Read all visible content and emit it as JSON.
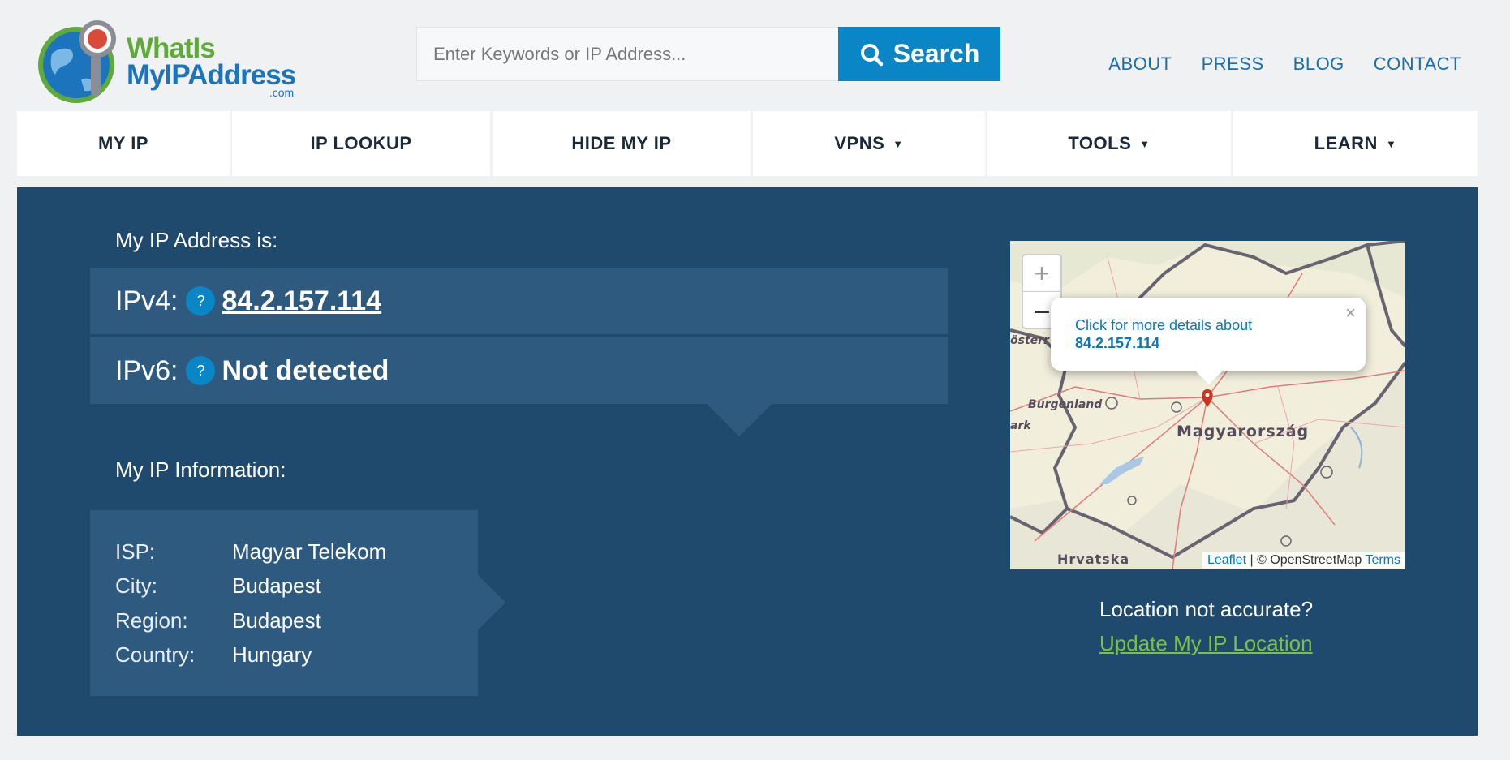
{
  "logo": {
    "line1": "WhatIs",
    "line2": "MyIPAddress",
    "line3": ".com"
  },
  "search": {
    "placeholder": "Enter Keywords or IP Address...",
    "button_label": "Search"
  },
  "top_links": [
    "ABOUT",
    "PRESS",
    "BLOG",
    "CONTACT"
  ],
  "nav": [
    {
      "label": "MY IP",
      "caret": ""
    },
    {
      "label": "IP LOOKUP",
      "caret": ""
    },
    {
      "label": "HIDE MY IP",
      "caret": ""
    },
    {
      "label": "VPNS",
      "caret": "▼"
    },
    {
      "label": "TOOLS",
      "caret": "▼"
    },
    {
      "label": "LEARN",
      "caret": "▼"
    }
  ],
  "ip": {
    "heading": "My IP Address is:",
    "ipv4_label": "IPv4:",
    "ipv4_value": "84.2.157.114",
    "ipv6_label": "IPv6:",
    "ipv6_value": "Not detected",
    "help": "?"
  },
  "info": {
    "heading": "My IP Information:",
    "rows": [
      {
        "key": "ISP:",
        "value": "Magyar Telekom"
      },
      {
        "key": "City:",
        "value": "Budapest"
      },
      {
        "key": "Region:",
        "value": "Budapest"
      },
      {
        "key": "Country:",
        "value": "Hungary"
      }
    ]
  },
  "map": {
    "zoom_in": "+",
    "zoom_out": "–",
    "popup_text": "Click for more details about",
    "popup_ip": "84.2.157.114",
    "popup_close": "×",
    "labels": {
      "country": "Magyarország",
      "burgenland": "Burgenland",
      "hrvatska": "Hrvatska",
      "osterr": "österr",
      "rk": "ark"
    },
    "attribution": {
      "leaflet": "Leaflet",
      "osm": "| © OpenStreetMap",
      "terms": "Terms"
    }
  },
  "location": {
    "question": "Location not accurate?",
    "update_link": "Update My IP Location"
  },
  "colors": {
    "accent": "#0a86c6",
    "hero_bg": "#20496e",
    "panel_bg": "#2e5a80",
    "link_green": "#7cc242"
  }
}
